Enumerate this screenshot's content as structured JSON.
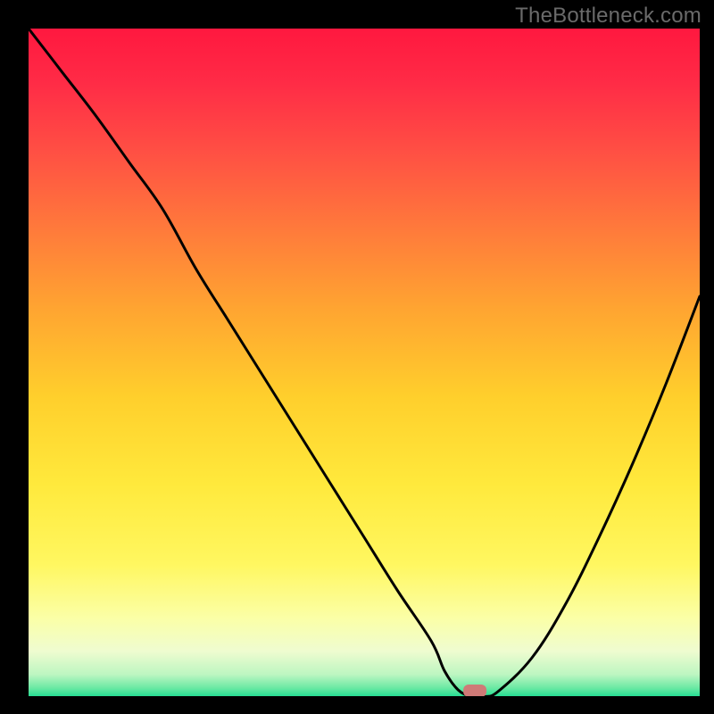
{
  "watermark": "TheBottleneck.com",
  "colors": {
    "curve": "#000000",
    "marker": "#cf7a77",
    "background_black": "#000000"
  },
  "chart_data": {
    "type": "line",
    "title": "",
    "xlabel": "",
    "ylabel": "",
    "xlim": [
      0,
      100
    ],
    "ylim": [
      0,
      100
    ],
    "grid": false,
    "series": [
      {
        "name": "bottleneck-curve",
        "x": [
          0,
          5,
          10,
          15,
          20,
          25,
          30,
          35,
          40,
          45,
          50,
          55,
          60,
          62,
          64,
          66,
          68,
          70,
          75,
          80,
          85,
          90,
          95,
          100
        ],
        "y": [
          100,
          93.5,
          87,
          80,
          73,
          64,
          56,
          48,
          40,
          32,
          24,
          16,
          8.5,
          4,
          1.2,
          0.2,
          0.2,
          1,
          6,
          14,
          24,
          35,
          47,
          60
        ]
      }
    ],
    "marker": {
      "x": 66.5,
      "y": 0.2,
      "label": ""
    },
    "flat_region_x": [
      63.5,
      68.5
    ],
    "annotations": []
  }
}
